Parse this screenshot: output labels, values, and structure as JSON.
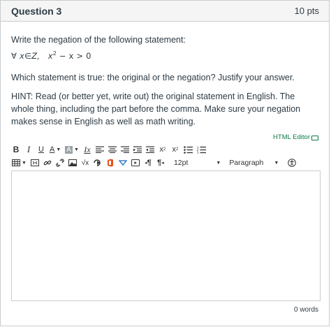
{
  "question": {
    "title": "Question 3",
    "points": "10 pts",
    "prompt": "Write the negation of the following statement:",
    "math": {
      "forall": "∀",
      "var": "x",
      "in_symbol": "∈",
      "set": "Z,",
      "expr_base": "x",
      "expr_exp": "2",
      "expr_rest": "− x > 0"
    },
    "paragraph2": "Which statement is true: the original or the negation? Justify your answer.",
    "paragraph3": "HINT: Read (or better yet, write out) the original statement in English.  The whole thing, including the part before the comma.  Make sure your negation makes sense in English as well as math writing."
  },
  "editor": {
    "html_editor_label": "HTML Editor",
    "toolbar_row1": {
      "bold": "B",
      "italic": "I",
      "underline": "U",
      "font_color": "A",
      "bg_color": "A",
      "clear_format": "Ix",
      "superscript_base": "x",
      "superscript_mark": "2",
      "subscript_base": "x",
      "subscript_mark": "2"
    },
    "toolbar_row2": {
      "math_equation": "√x",
      "paragraph_ltr": "¶",
      "paragraph_rtl": "¶",
      "font_size": "12pt",
      "block_format": "Paragraph"
    },
    "word_count": "0 words"
  },
  "colors": {
    "link_green": "#0a7a48",
    "office_orange": "#e8501b",
    "media_blue": "#3d7dc7",
    "text_dark": "#2d3b45",
    "border": "#c7cdd1"
  }
}
